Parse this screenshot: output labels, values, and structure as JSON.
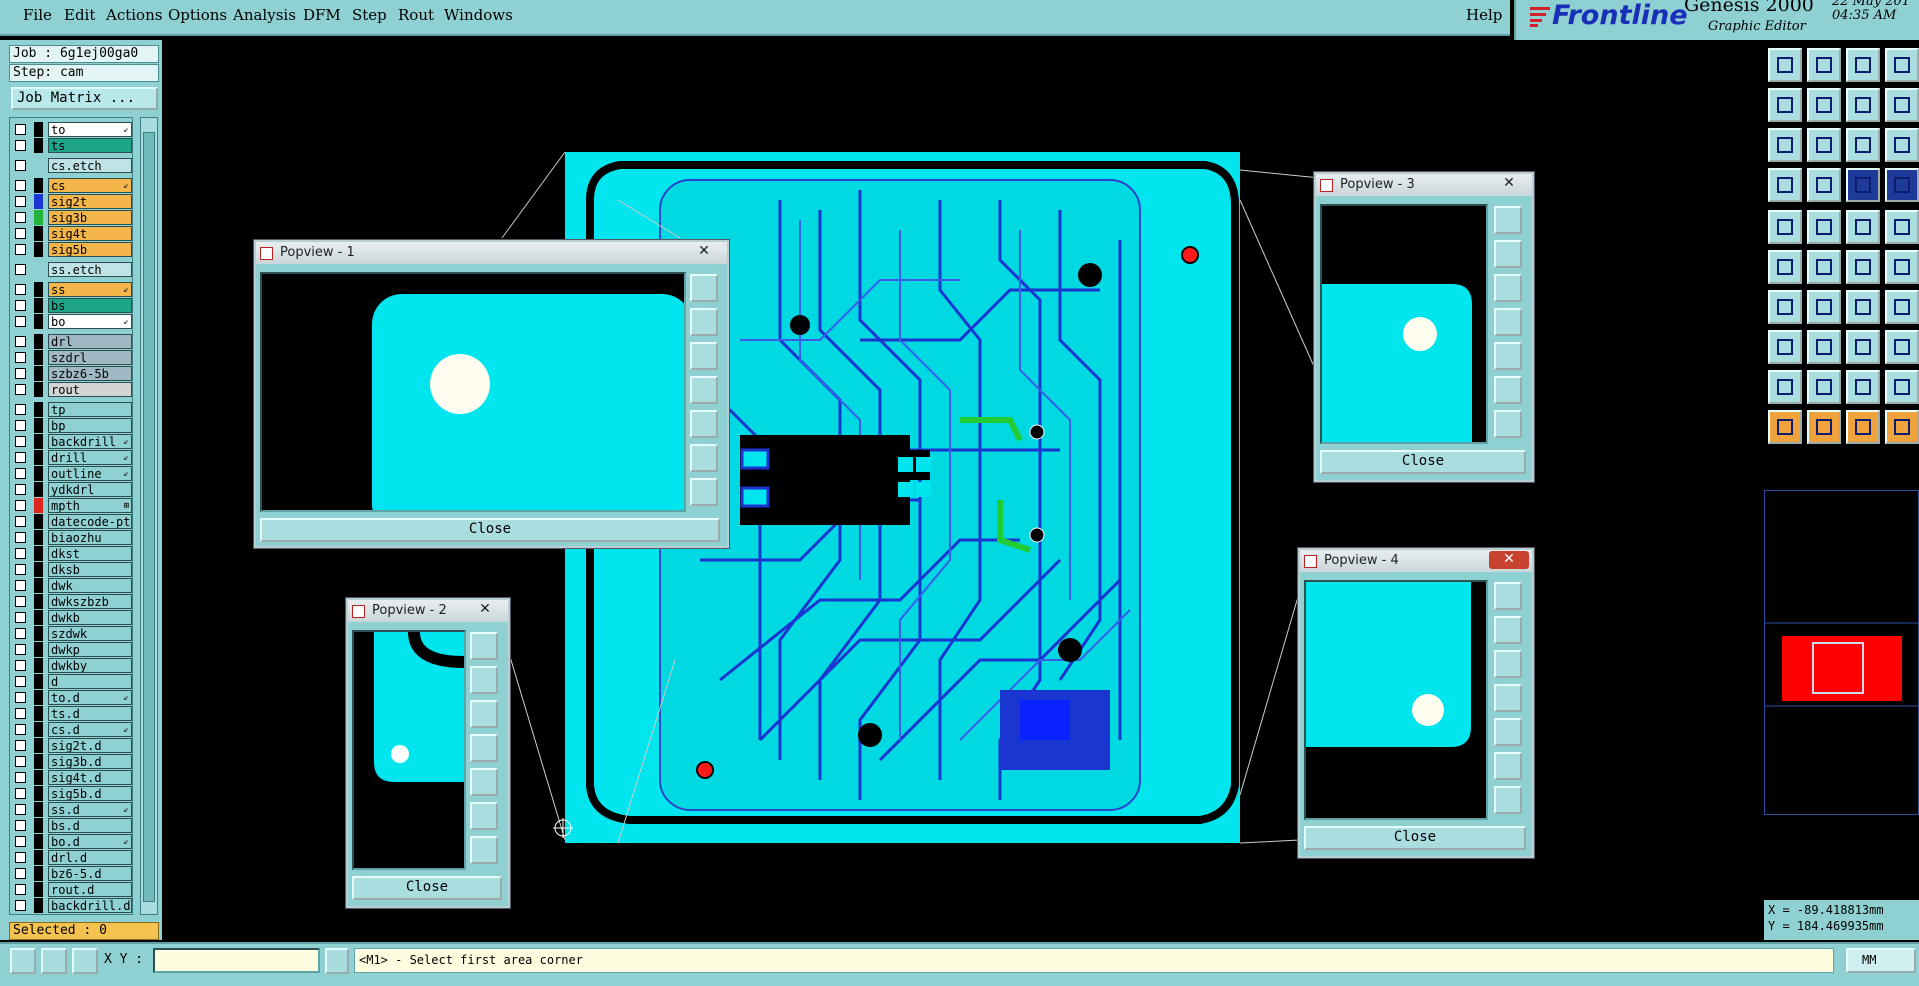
{
  "menu": {
    "items": [
      "File",
      "Edit",
      "Actions",
      "Options",
      "Analysis",
      "DFM",
      "Step",
      "Rout",
      "Windows"
    ],
    "help": "Help"
  },
  "header": {
    "brand": "Frontline",
    "product": "Genesis 2000",
    "subtitle": "Graphic Editor",
    "date": "22 May 201",
    "time": "04:35 AM"
  },
  "job": {
    "job_line": "Job : 6g1ej00ga0",
    "step_line": "Step: cam",
    "matrix_button": "Job Matrix ..."
  },
  "layers": [
    {
      "name": "to",
      "color": "#ffffff",
      "swatch": "#000000",
      "mark": "⇙"
    },
    {
      "name": "ts",
      "color": "#1fa58a",
      "swatch": "#000000",
      "mark": ""
    },
    {
      "name": "cs.etch",
      "color": "#bfe3e6",
      "swatch": "#8fd0d2",
      "mark": ""
    },
    {
      "name": "cs",
      "color": "#f4b64a",
      "swatch": "#000000",
      "mark": "⇙"
    },
    {
      "name": "sig2t",
      "color": "#f4b64a",
      "swatch": "#1a35d0",
      "mark": ""
    },
    {
      "name": "sig3b",
      "color": "#f4b64a",
      "swatch": "#22b43a",
      "mark": ""
    },
    {
      "name": "sig4t",
      "color": "#f4b64a",
      "swatch": "#000000",
      "mark": ""
    },
    {
      "name": "sig5b",
      "color": "#f4b64a",
      "swatch": "#000000",
      "mark": ""
    },
    {
      "name": "ss.etch",
      "color": "#bfe3e6",
      "swatch": "#8fd0d2",
      "mark": ""
    },
    {
      "name": "ss",
      "color": "#f4b64a",
      "swatch": "#000000",
      "mark": "⇙"
    },
    {
      "name": "bs",
      "color": "#1fa58a",
      "swatch": "#000000",
      "mark": ""
    },
    {
      "name": "bo",
      "color": "#ffffff",
      "swatch": "#000000",
      "mark": "⇙"
    },
    {
      "name": "drl",
      "color": "#9fb8c4",
      "swatch": "#000000",
      "mark": ""
    },
    {
      "name": "szdrl",
      "color": "#9fb8c4",
      "swatch": "#000000",
      "mark": ""
    },
    {
      "name": "szbz6-5b",
      "color": "#9fb8c4",
      "swatch": "#000000",
      "mark": ""
    },
    {
      "name": "rout",
      "color": "#d4d4d4",
      "swatch": "#000000",
      "mark": ""
    },
    {
      "name": "tp",
      "color": "#8fd0d2",
      "swatch": "#000000",
      "mark": ""
    },
    {
      "name": "bp",
      "color": "#8fd0d2",
      "swatch": "#000000",
      "mark": ""
    },
    {
      "name": "backdrill",
      "color": "#8fd0d2",
      "swatch": "#000000",
      "mark": "⇙"
    },
    {
      "name": "drill",
      "color": "#8fd0d2",
      "swatch": "#000000",
      "mark": "⇙"
    },
    {
      "name": "outline",
      "color": "#8fd0d2",
      "swatch": "#000000",
      "mark": "⇙"
    },
    {
      "name": "ydkdrl",
      "color": "#8fd0d2",
      "swatch": "#000000",
      "mark": ""
    },
    {
      "name": "mpth",
      "color": "#8fd0d2",
      "swatch": "#e0271f",
      "mark": "⊞"
    },
    {
      "name": "datecode-pt",
      "color": "#8fd0d2",
      "swatch": "#000000",
      "mark": ""
    },
    {
      "name": "biaozhu",
      "color": "#8fd0d2",
      "swatch": "#000000",
      "mark": ""
    },
    {
      "name": "dkst",
      "color": "#8fd0d2",
      "swatch": "#000000",
      "mark": ""
    },
    {
      "name": "dksb",
      "color": "#8fd0d2",
      "swatch": "#000000",
      "mark": ""
    },
    {
      "name": "dwk",
      "color": "#8fd0d2",
      "swatch": "#000000",
      "mark": ""
    },
    {
      "name": "dwkszbzb",
      "color": "#8fd0d2",
      "swatch": "#000000",
      "mark": ""
    },
    {
      "name": "dwkb",
      "color": "#8fd0d2",
      "swatch": "#000000",
      "mark": ""
    },
    {
      "name": "szdwk",
      "color": "#8fd0d2",
      "swatch": "#000000",
      "mark": ""
    },
    {
      "name": "dwkp",
      "color": "#8fd0d2",
      "swatch": "#000000",
      "mark": ""
    },
    {
      "name": "dwkby",
      "color": "#8fd0d2",
      "swatch": "#000000",
      "mark": ""
    },
    {
      "name": "d",
      "color": "#8fd0d2",
      "swatch": "#000000",
      "mark": ""
    },
    {
      "name": "to.d",
      "color": "#8fd0d2",
      "swatch": "#000000",
      "mark": "⇙"
    },
    {
      "name": "ts.d",
      "color": "#8fd0d2",
      "swatch": "#000000",
      "mark": ""
    },
    {
      "name": "cs.d",
      "color": "#8fd0d2",
      "swatch": "#000000",
      "mark": "⇙"
    },
    {
      "name": "sig2t.d",
      "color": "#8fd0d2",
      "swatch": "#000000",
      "mark": ""
    },
    {
      "name": "sig3b.d",
      "color": "#8fd0d2",
      "swatch": "#000000",
      "mark": ""
    },
    {
      "name": "sig4t.d",
      "color": "#8fd0d2",
      "swatch": "#000000",
      "mark": ""
    },
    {
      "name": "sig5b.d",
      "color": "#8fd0d2",
      "swatch": "#000000",
      "mark": ""
    },
    {
      "name": "ss.d",
      "color": "#8fd0d2",
      "swatch": "#000000",
      "mark": "⇙"
    },
    {
      "name": "bs.d",
      "color": "#8fd0d2",
      "swatch": "#000000",
      "mark": ""
    },
    {
      "name": "bo.d",
      "color": "#8fd0d2",
      "swatch": "#000000",
      "mark": "⇙"
    },
    {
      "name": "drl.d",
      "color": "#8fd0d2",
      "swatch": "#000000",
      "mark": ""
    },
    {
      "name": "bz6-5.d",
      "color": "#8fd0d2",
      "swatch": "#000000",
      "mark": ""
    },
    {
      "name": "rout.d",
      "color": "#8fd0d2",
      "swatch": "#000000",
      "mark": ""
    },
    {
      "name": "backdrill.d",
      "color": "#8fd0d2",
      "swatch": "#000000",
      "mark": ""
    }
  ],
  "status": {
    "selected": "Selected : 0",
    "xy_label": "X Y :",
    "xy_value": "",
    "prompt": "<M1> - Select first area corner",
    "units": "MM",
    "coord_x": "X = -89.418813mm",
    "coord_y": "Y = 184.469935mm"
  },
  "popups": [
    {
      "title": "Popview - 1",
      "close": "Close"
    },
    {
      "title": "Popview - 2",
      "close": "Close"
    },
    {
      "title": "Popview - 3",
      "close": "Close"
    },
    {
      "title": "Popview - 4",
      "close": "Close"
    }
  ],
  "colors": {
    "panel": "#8fd0d2",
    "board": "#00e5ee",
    "trace": "#1a35d0",
    "highlight_red": "#ff0000"
  }
}
